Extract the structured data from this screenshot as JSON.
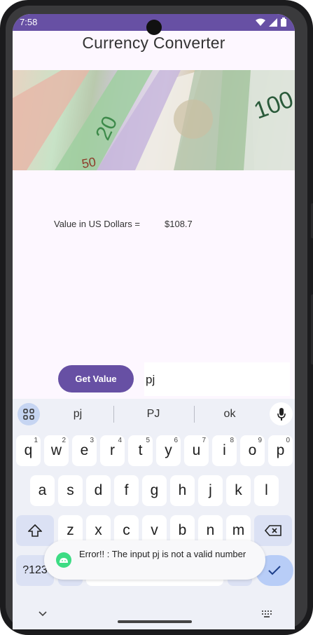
{
  "status_bar": {
    "time": "7:58"
  },
  "app": {
    "title": "Currency Converter"
  },
  "result": {
    "label": "Value in US Dollars =",
    "amount": "$108.7"
  },
  "form": {
    "button_label": "Get Value",
    "input_value": "pj"
  },
  "keyboard": {
    "suggestions": [
      "pj",
      "PJ",
      "ok"
    ],
    "row1": [
      {
        "key": "q",
        "hint": "1"
      },
      {
        "key": "w",
        "hint": "2"
      },
      {
        "key": "e",
        "hint": "3"
      },
      {
        "key": "r",
        "hint": "4"
      },
      {
        "key": "t",
        "hint": "5"
      },
      {
        "key": "y",
        "hint": "6"
      },
      {
        "key": "u",
        "hint": "7"
      },
      {
        "key": "i",
        "hint": "8"
      },
      {
        "key": "o",
        "hint": "9"
      },
      {
        "key": "p",
        "hint": "0"
      }
    ],
    "row2": [
      "a",
      "s",
      "d",
      "f",
      "g",
      "h",
      "j",
      "k",
      "l"
    ],
    "row3": [
      "z",
      "x",
      "c",
      "v",
      "b",
      "n",
      "m"
    ],
    "symbols_label": "?123",
    "comma_label": ","
  },
  "toast": {
    "message": "Error!! : The input pj is not a valid number"
  },
  "colors": {
    "primary": "#6750a4",
    "background": "#fdf7ff",
    "keyboard_bg": "#eef0f7"
  }
}
